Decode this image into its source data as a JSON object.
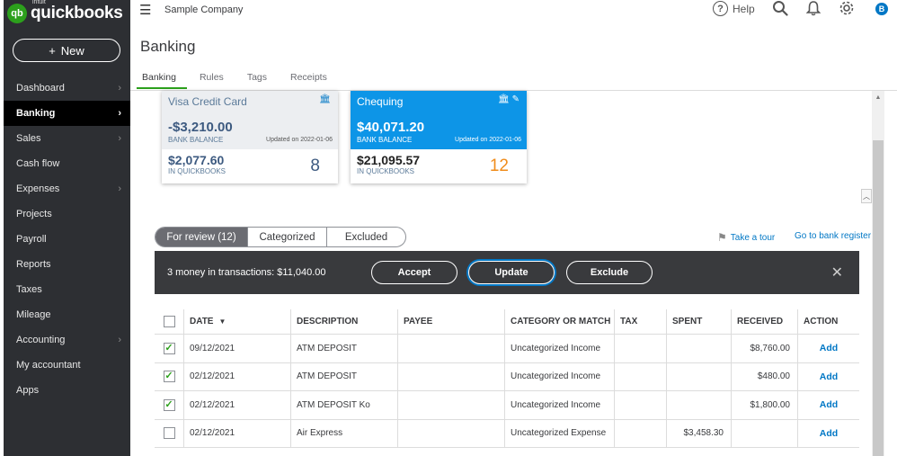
{
  "brand": {
    "intuit": "intuit",
    "name": "quickbooks",
    "mark": "qb"
  },
  "sidebar": {
    "new_button": "New",
    "items": [
      {
        "label": "Dashboard",
        "chevron": true,
        "active": false
      },
      {
        "label": "Banking",
        "chevron": true,
        "active": true
      },
      {
        "label": "Sales",
        "chevron": true,
        "active": false
      },
      {
        "label": "Cash flow",
        "chevron": false,
        "active": false
      },
      {
        "label": "Expenses",
        "chevron": true,
        "active": false
      },
      {
        "label": "Projects",
        "chevron": false,
        "active": false
      },
      {
        "label": "Payroll",
        "chevron": false,
        "active": false
      },
      {
        "label": "Reports",
        "chevron": false,
        "active": false
      },
      {
        "label": "Taxes",
        "chevron": false,
        "active": false
      },
      {
        "label": "Mileage",
        "chevron": false,
        "active": false
      },
      {
        "label": "Accounting",
        "chevron": true,
        "active": false
      },
      {
        "label": "My accountant",
        "chevron": false,
        "active": false
      },
      {
        "label": "Apps",
        "chevron": false,
        "active": false
      }
    ]
  },
  "topbar": {
    "company": "Sample Company",
    "help": "Help",
    "avatar_initial": "B"
  },
  "page": {
    "title": "Banking"
  },
  "tabs": [
    "Banking",
    "Rules",
    "Tags",
    "Receipts"
  ],
  "cards": {
    "visa": {
      "name": "Visa Credit Card",
      "bank_balance": "-$3,210.00",
      "bank_label": "BANK BALANCE",
      "updated": "Updated on 2022-01-06",
      "qb_balance": "$2,077.60",
      "qb_label": "IN QUICKBOOKS",
      "count": "8"
    },
    "chequing": {
      "name": "Chequing",
      "bank_balance": "$40,071.20",
      "bank_label": "BANK BALANCE",
      "updated": "Updated on 2022-01-06",
      "qb_balance": "$21,095.57",
      "qb_label": "IN QUICKBOOKS",
      "count": "12"
    }
  },
  "filter_tabs": {
    "for_review": "For review (12)",
    "categorized": "Categorized",
    "excluded": "Excluded"
  },
  "links": {
    "take_tour": "Take a tour",
    "bank_register": "Go to bank register"
  },
  "action_bar": {
    "summary": "3 money in transactions: $11,040.00",
    "accept": "Accept",
    "update": "Update",
    "exclude": "Exclude"
  },
  "table": {
    "headers": {
      "date": "DATE",
      "description": "DESCRIPTION",
      "payee": "PAYEE",
      "category": "CATEGORY OR MATCH",
      "tax": "TAX",
      "spent": "SPENT",
      "received": "RECEIVED",
      "action": "ACTION"
    },
    "rows": [
      {
        "checked": true,
        "date": "09/12/2021",
        "description": "ATM DEPOSIT",
        "payee": "",
        "category": "Uncategorized Income",
        "tax": "",
        "spent": "",
        "received": "$8,760.00",
        "action": "Add"
      },
      {
        "checked": true,
        "date": "02/12/2021",
        "description": "ATM DEPOSIT",
        "payee": "",
        "category": "Uncategorized Income",
        "tax": "",
        "spent": "",
        "received": "$480.00",
        "action": "Add"
      },
      {
        "checked": true,
        "date": "02/12/2021",
        "description": "ATM DEPOSIT Ko",
        "payee": "",
        "category": "Uncategorized Income",
        "tax": "",
        "spent": "",
        "received": "$1,800.00",
        "action": "Add"
      },
      {
        "checked": false,
        "date": "02/12/2021",
        "description": "Air Express",
        "payee": "",
        "category": "Uncategorized Expense",
        "tax": "",
        "spent": "$3,458.30",
        "received": "",
        "action": "Add"
      }
    ]
  },
  "colors": {
    "brand_green": "#2ca01c",
    "sidebar_bg": "#2d2f33",
    "link_blue": "#0077c5",
    "card_blue": "#0d95e7",
    "count_orange": "#f08c1b"
  }
}
